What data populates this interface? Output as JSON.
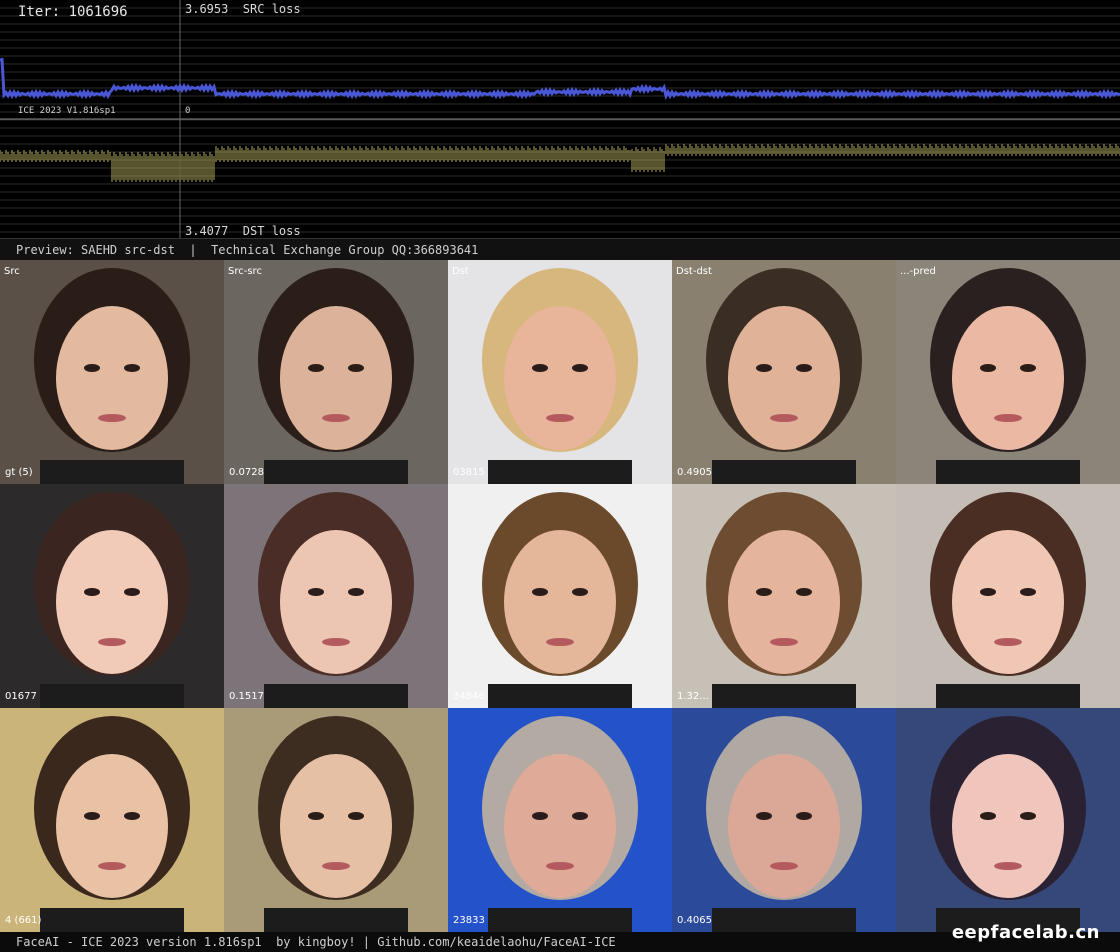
{
  "graph": {
    "iter_label": "Iter: 1061696",
    "src_loss": "3.6953  SRC loss",
    "dst_loss": "3.4077  DST loss",
    "version_small": "ICE 2023 V1.816sp1",
    "zero_label": "0",
    "colors": {
      "src": "#4a58d8",
      "dst": "#c9c46a",
      "grid": "#2a2a2a"
    }
  },
  "preview_bar": {
    "text": "Preview: SAEHD src-dst  |  Technical Exchange Group QQ:366893641"
  },
  "columns": [
    "Src",
    "Src-src",
    "Dst",
    "Dst-dst",
    "Src-pred"
  ],
  "rows": [
    {
      "cells": [
        {
          "label": "Src",
          "value": "gt (5)"
        },
        {
          "label": "Src-src",
          "value": "0.0728"
        },
        {
          "label": "Dst",
          "value": "03815"
        },
        {
          "label": "Dst-dst",
          "value": "0.4905"
        },
        {
          "label": "...-pred",
          "value": ""
        }
      ]
    },
    {
      "cells": [
        {
          "label": "",
          "value": "01677"
        },
        {
          "label": "",
          "value": "0.1517"
        },
        {
          "label": "",
          "value": "34846"
        },
        {
          "label": "",
          "value": "1.32..."
        },
        {
          "label": "",
          "value": ""
        }
      ]
    },
    {
      "cells": [
        {
          "label": "",
          "value": "4 (661)"
        },
        {
          "label": "",
          "value": ""
        },
        {
          "label": "",
          "value": "23833"
        },
        {
          "label": "",
          "value": "0.4065"
        },
        {
          "label": "",
          "value": ""
        }
      ]
    }
  ],
  "footer": {
    "text": "FaceAI - ICE 2023 version 1.816sp1  by kingboy! | Github.com/keaidelaohu/FaceAI-ICE",
    "watermark": "eepfacelab.cn"
  }
}
